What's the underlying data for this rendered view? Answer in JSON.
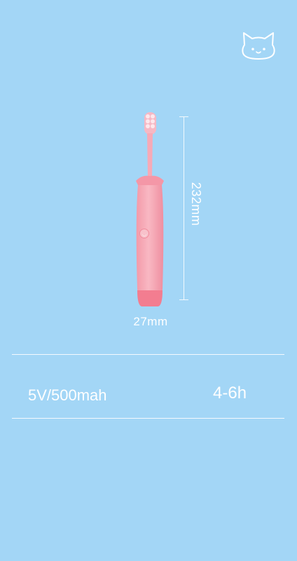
{
  "dimensions": {
    "height": "232mm",
    "width": "27mm"
  },
  "specs": {
    "battery": "5V/500mah",
    "charge_time": "4-6h"
  },
  "icons": {
    "top_right": "cat-face-icon"
  },
  "colors": {
    "background": "#a3d6f6",
    "brush_body": "#f6a9b6",
    "brush_base": "#f37d90",
    "text": "#ffffff"
  }
}
